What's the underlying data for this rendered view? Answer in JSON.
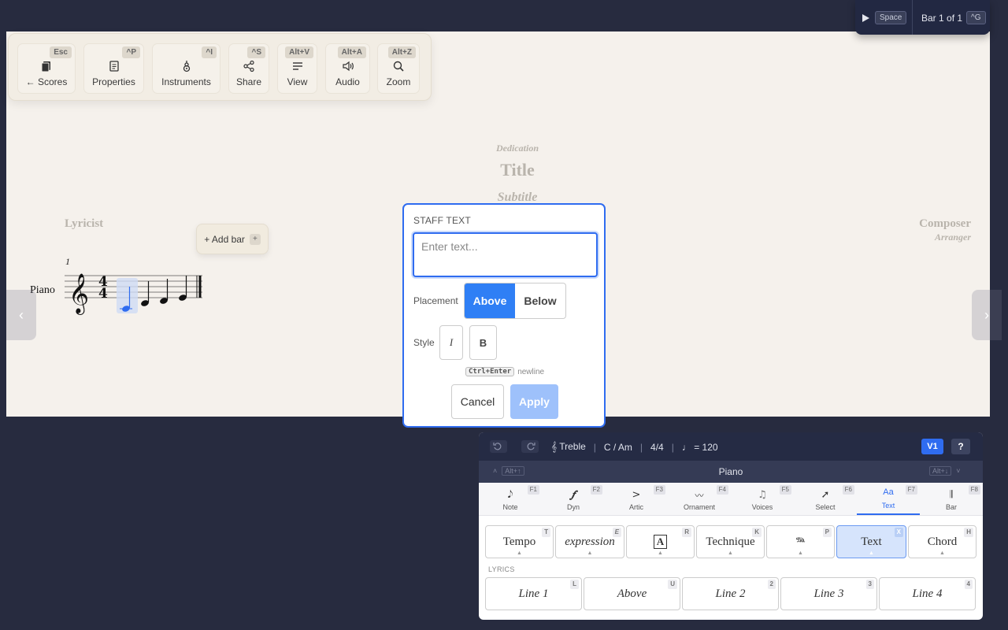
{
  "playback": {
    "play_key": "Space",
    "position": "Bar 1 of 1",
    "goto_key": "^G"
  },
  "toolbar": {
    "items": [
      {
        "label": "← Scores",
        "key": "Esc"
      },
      {
        "label": "Properties",
        "key": "^P"
      },
      {
        "label": "Instruments",
        "key": "^I"
      },
      {
        "label": "Share",
        "key": "^S"
      },
      {
        "label": "View",
        "key": "Alt+V"
      },
      {
        "label": "Audio",
        "key": "Alt+A"
      },
      {
        "label": "Zoom",
        "key": "Alt+Z"
      }
    ]
  },
  "score": {
    "dedication": "Dedication",
    "title": "Title",
    "subtitle": "Subtitle",
    "lyricist": "Lyricist",
    "composer": "Composer",
    "arranger": "Arranger",
    "instrument": "Piano",
    "bar_number": "1",
    "add_bar": "+ Add bar",
    "add_bar_key": "+"
  },
  "dialog": {
    "title": "STAFF TEXT",
    "placeholder": "Enter text...",
    "placement_label": "Placement",
    "placement_options": [
      "Above",
      "Below"
    ],
    "placement_selected": "Above",
    "style_label": "Style",
    "italic": "I",
    "bold": "B",
    "hint_key": "Ctrl+Enter",
    "hint_text": "newline",
    "cancel": "Cancel",
    "apply": "Apply"
  },
  "panel": {
    "status": {
      "clef": "𝄞 Treble",
      "key": "C / Am",
      "time": "4/4",
      "tempo": "♩ = 120",
      "voice": "V1",
      "help": "?"
    },
    "instrument": {
      "name": "Piano",
      "prev_key": "Alt+↑",
      "next_key": "Alt+↓"
    },
    "tabs": [
      {
        "label": "Note",
        "key": "F1",
        "glyph": "𝅘𝅥𝅮"
      },
      {
        "label": "Dyn",
        "key": "F2",
        "glyph": "𝆑"
      },
      {
        "label": "Artic",
        "key": "F3",
        "glyph": ">"
      },
      {
        "label": "Ornament",
        "key": "F4",
        "glyph": "〰"
      },
      {
        "label": "Voices",
        "key": "F5",
        "glyph": "♫"
      },
      {
        "label": "Select",
        "key": "F6",
        "glyph": "➚"
      },
      {
        "label": "Text",
        "key": "F7",
        "glyph": "Aa"
      },
      {
        "label": "Bar",
        "key": "F8",
        "glyph": "𝄂"
      }
    ],
    "text_buttons": [
      {
        "label": "Tempo",
        "key": "T"
      },
      {
        "label": "expression",
        "key": "E"
      },
      {
        "label": "A",
        "key": "R"
      },
      {
        "label": "Technique",
        "key": "K"
      },
      {
        "label": "𝆮",
        "key": "P"
      },
      {
        "label": "Text",
        "key": "X"
      },
      {
        "label": "Chord",
        "key": "H"
      }
    ],
    "lyrics_label": "LYRICS",
    "lyrics_buttons": [
      {
        "label": "Line 1",
        "key": "L"
      },
      {
        "label": "Above",
        "key": "U"
      },
      {
        "label": "Line 2",
        "key": "2"
      },
      {
        "label": "Line 3",
        "key": "3"
      },
      {
        "label": "Line 4",
        "key": "4"
      }
    ]
  }
}
